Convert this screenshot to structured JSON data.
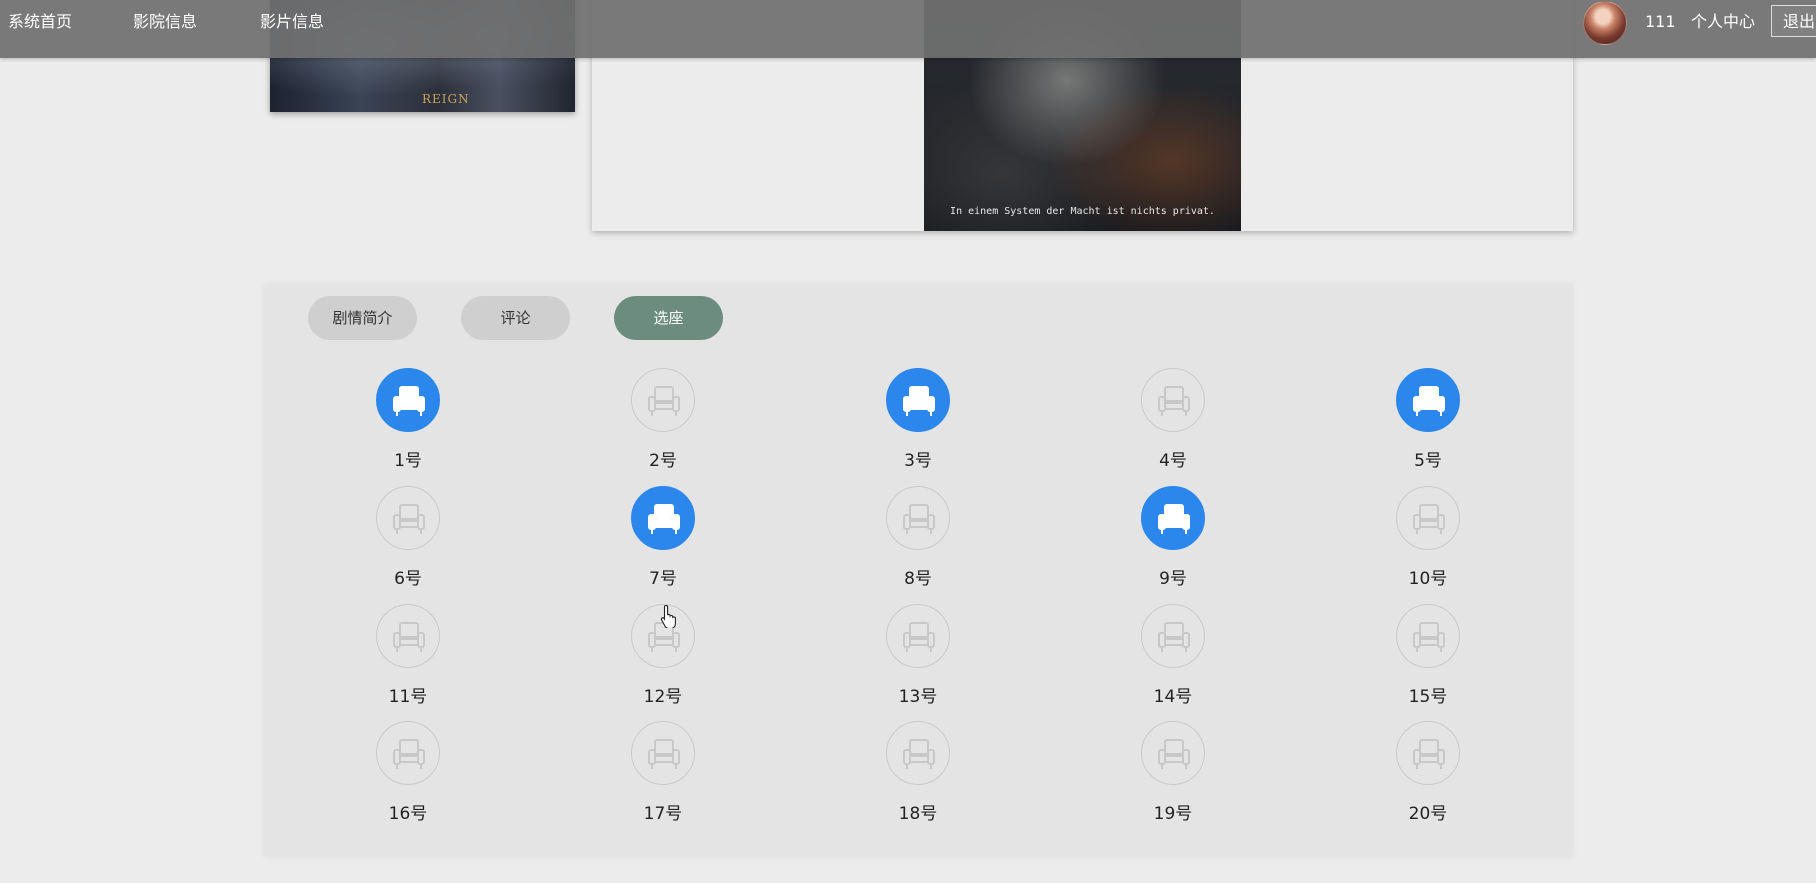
{
  "nav": {
    "links": [
      "系统首页",
      "影院信息",
      "影片信息"
    ],
    "username": "111",
    "user_center": "个人中心",
    "logout": "退出"
  },
  "banner": {
    "poster_text": "REIGN",
    "video_caption": "In einem System der Macht ist nichts privat."
  },
  "tabs": [
    {
      "label": "剧情简介",
      "active": false
    },
    {
      "label": "评论",
      "active": false
    },
    {
      "label": "选座",
      "active": true
    }
  ],
  "seats": [
    {
      "label": "1号",
      "selected": true
    },
    {
      "label": "2号",
      "selected": false
    },
    {
      "label": "3号",
      "selected": true
    },
    {
      "label": "4号",
      "selected": false
    },
    {
      "label": "5号",
      "selected": true
    },
    {
      "label": "6号",
      "selected": false
    },
    {
      "label": "7号",
      "selected": true
    },
    {
      "label": "8号",
      "selected": false
    },
    {
      "label": "9号",
      "selected": true
    },
    {
      "label": "10号",
      "selected": false
    },
    {
      "label": "11号",
      "selected": false
    },
    {
      "label": "12号",
      "selected": false
    },
    {
      "label": "13号",
      "selected": false
    },
    {
      "label": "14号",
      "selected": false
    },
    {
      "label": "15号",
      "selected": false
    },
    {
      "label": "16号",
      "selected": false
    },
    {
      "label": "17号",
      "selected": false
    },
    {
      "label": "18号",
      "selected": false
    },
    {
      "label": "19号",
      "selected": false
    },
    {
      "label": "20号",
      "selected": false
    }
  ],
  "colors": {
    "selected_seat": "#2b87ec",
    "active_tab": "#6d8c80",
    "nav_bg": "#707070"
  },
  "icons": {
    "seat": "armchair-icon",
    "cursor": "hand-pointer-icon"
  }
}
